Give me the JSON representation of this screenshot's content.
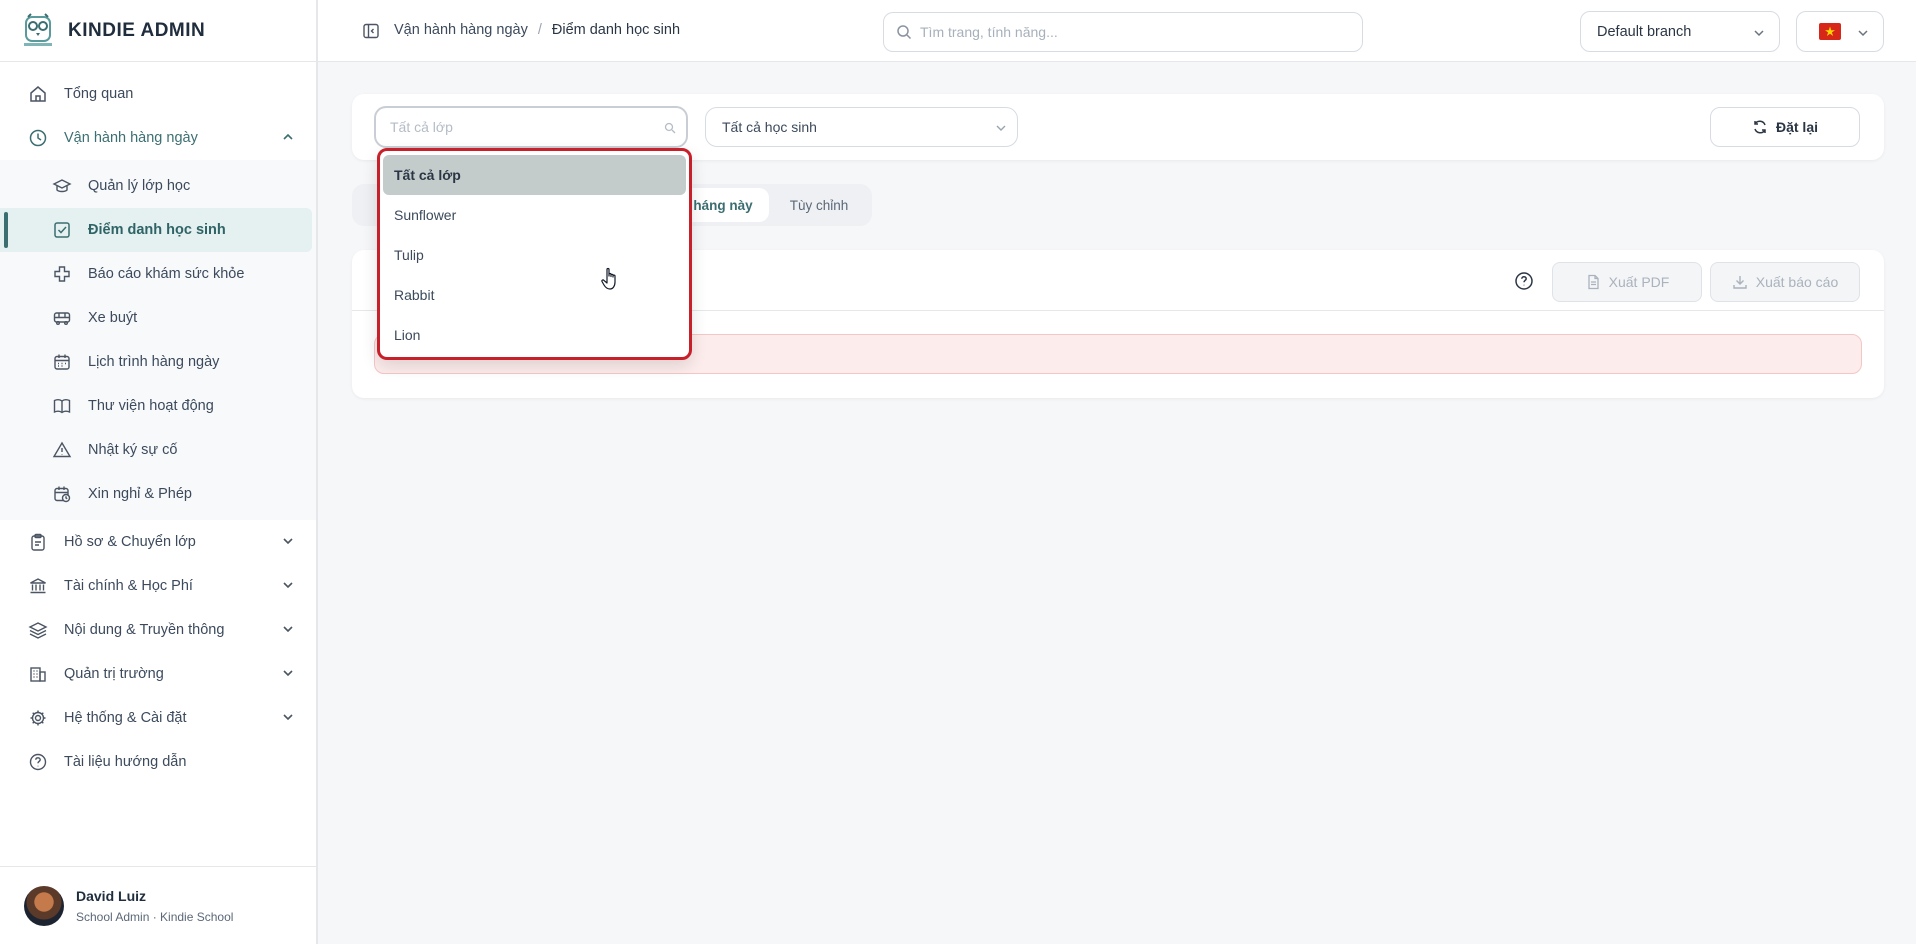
{
  "app": {
    "title": "KINDIE ADMIN"
  },
  "sidebar": {
    "items": [
      {
        "label": "Tổng quan",
        "icon": "home-icon"
      },
      {
        "label": "Vận hành hàng ngày",
        "icon": "clock-icon",
        "expanded": true,
        "children": [
          {
            "label": "Quản lý lớp học",
            "icon": "graduation-cap-icon"
          },
          {
            "label": "Điểm danh học sinh",
            "icon": "checkbox-icon",
            "active": true
          },
          {
            "label": "Báo cáo khám sức khỏe",
            "icon": "health-cross-icon"
          },
          {
            "label": "Xe buýt",
            "icon": "bus-icon"
          },
          {
            "label": "Lịch trình hàng ngày",
            "icon": "calendar-icon"
          },
          {
            "label": "Thư viện hoạt động",
            "icon": "book-icon"
          },
          {
            "label": "Nhật ký sự cố",
            "icon": "warning-icon"
          },
          {
            "label": "Xin nghỉ & Phép",
            "icon": "calendar-clock-icon"
          }
        ]
      },
      {
        "label": "Hồ sơ & Chuyển lớp",
        "icon": "clipboard-icon"
      },
      {
        "label": "Tài chính & Học Phí",
        "icon": "bank-icon"
      },
      {
        "label": "Nội dung & Truyền thông",
        "icon": "layers-icon"
      },
      {
        "label": "Quản trị trường",
        "icon": "building-icon"
      },
      {
        "label": "Hệ thống & Cài đặt",
        "icon": "gear-icon"
      },
      {
        "label": "Tài liệu hướng dẫn",
        "icon": "help-circle-icon"
      }
    ]
  },
  "user": {
    "name": "David Luiz",
    "role": "School Admin · Kindie School"
  },
  "topbar": {
    "breadcrumb": {
      "parent": "Vận hành hàng ngày",
      "separator": "/",
      "current": "Điểm danh học sinh"
    },
    "search_placeholder": "Tìm trang, tính năng...",
    "branch": "Default branch",
    "flag_color": "#d62718"
  },
  "filters": {
    "class_placeholder": "Tất cả lớp",
    "student_select": "Tất cả học sinh",
    "reset_label": "Đặt lại"
  },
  "tabs": {
    "month_partial": "háng này",
    "custom": "Tùy chỉnh"
  },
  "report": {
    "pdf_label": "Xuất PDF",
    "export_label": "Xuất báo cáo"
  },
  "dropdown": {
    "options": [
      "Tất cả lớp",
      "Sunflower",
      "Tulip",
      "Rabbit",
      "Lion"
    ],
    "selected": "Tất cả lớp",
    "highlight_color": "#c8202a"
  },
  "colors": {
    "accent": "#3b6e70",
    "active_bg": "#e5f0f0"
  }
}
